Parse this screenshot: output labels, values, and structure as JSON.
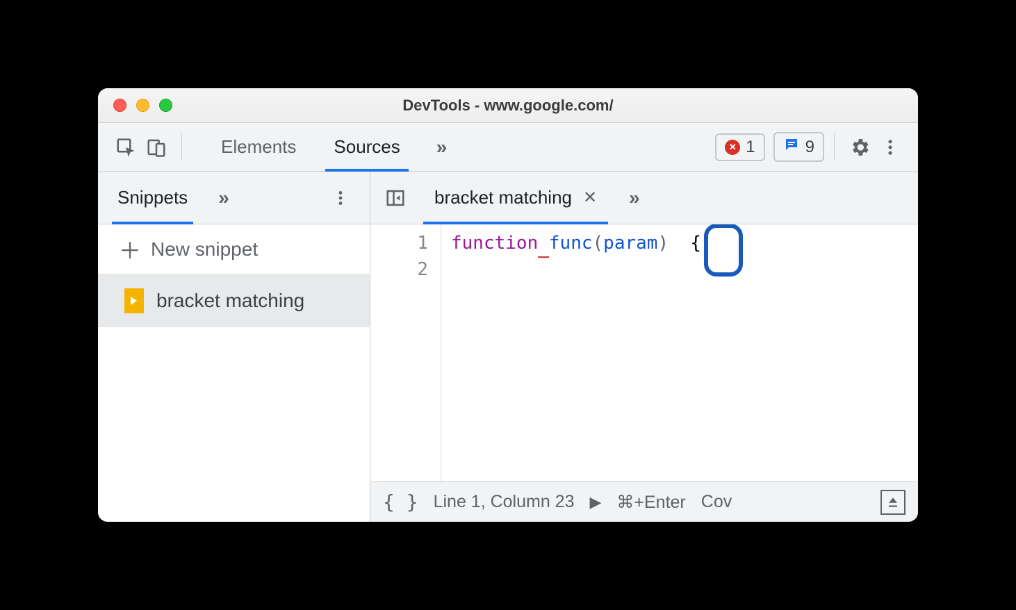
{
  "window": {
    "title": "DevTools - www.google.com/"
  },
  "toolbar": {
    "tabs": [
      "Elements",
      "Sources"
    ],
    "active_tab": "Sources",
    "error_count": "1",
    "message_count": "9"
  },
  "sidebar": {
    "tab": "Snippets",
    "new_snippet_label": "New snippet",
    "items": [
      "bracket matching"
    ]
  },
  "editor": {
    "tab_label": "bracket matching",
    "lines": [
      "1",
      "2"
    ],
    "code": {
      "keyword": "function",
      "name": "func",
      "paren_open": "(",
      "param": "param",
      "paren_close": ")",
      "brace": "{"
    }
  },
  "status": {
    "position": "Line 1, Column 23",
    "run_hint": "⌘+Enter",
    "coverage": "Cov"
  }
}
